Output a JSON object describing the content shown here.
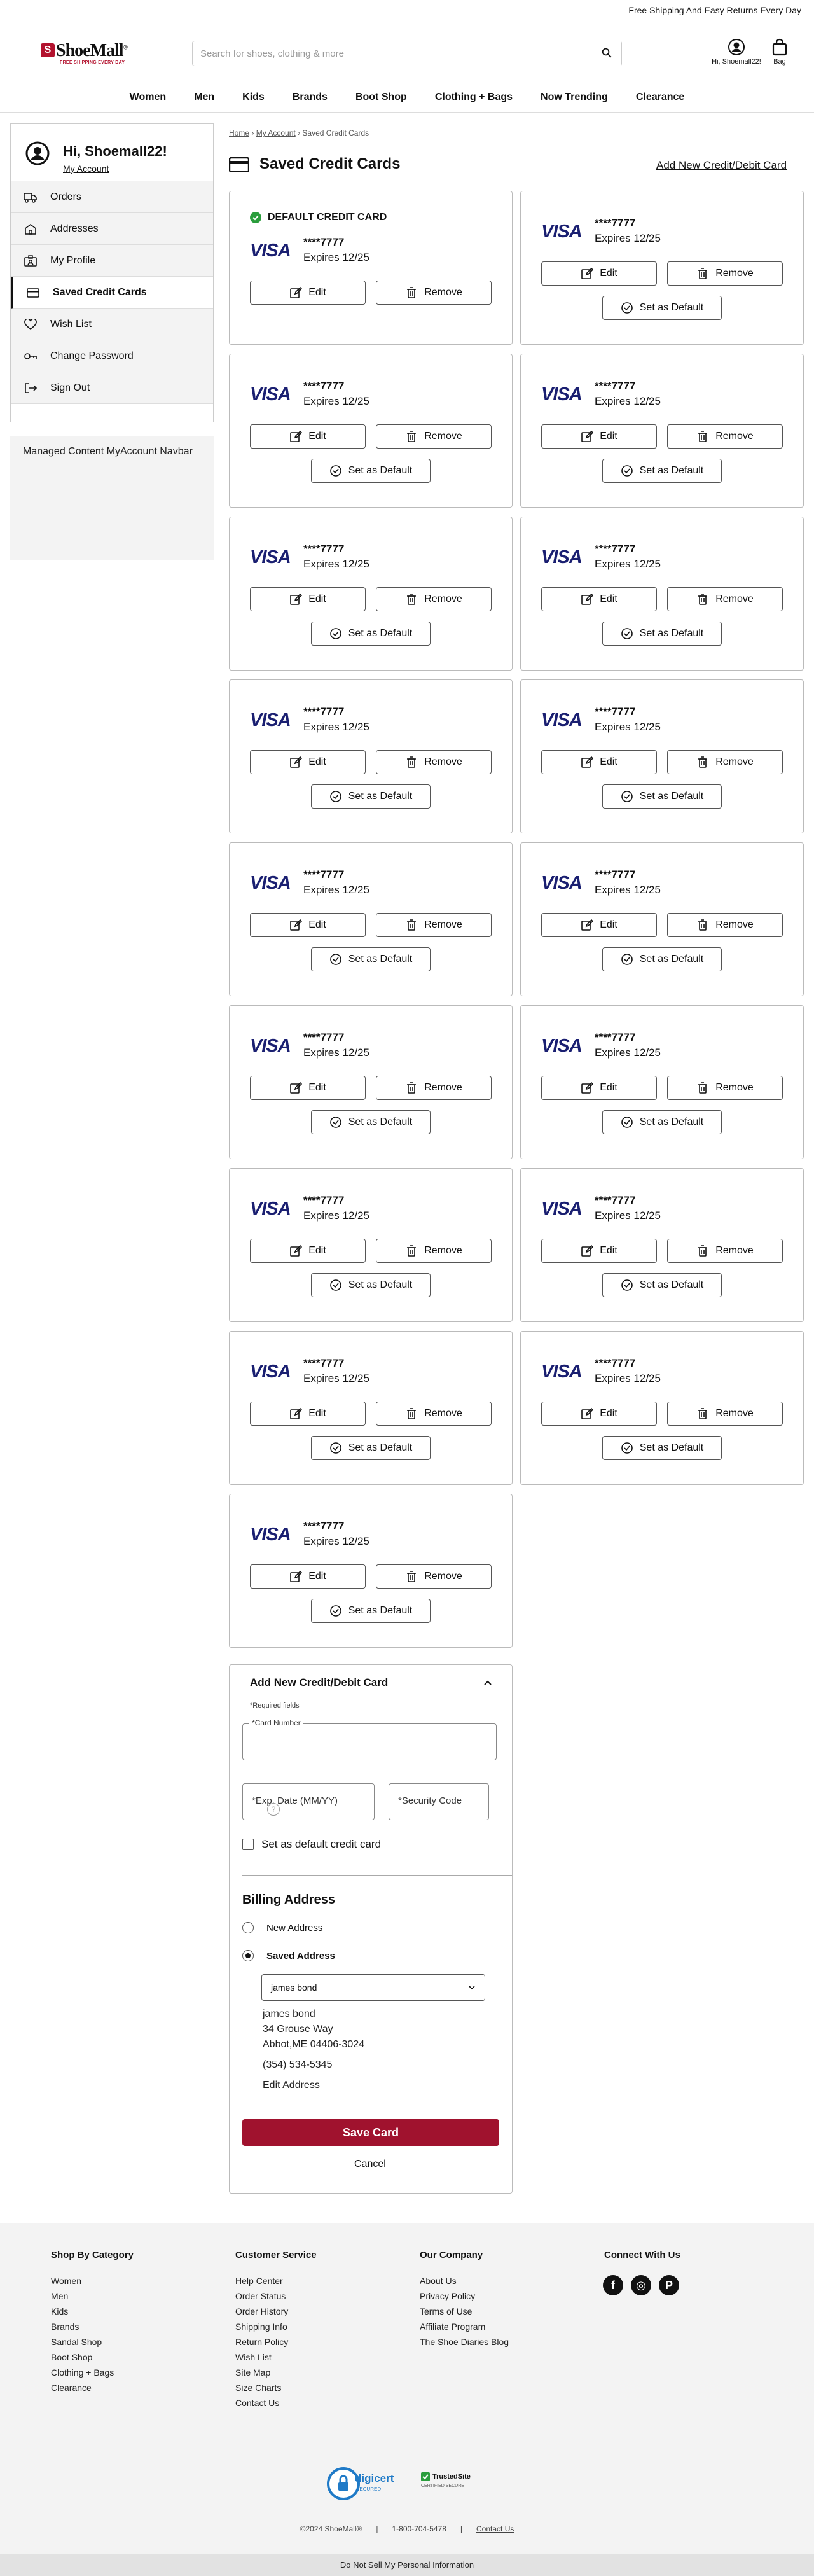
{
  "topbar": {
    "promo": "Free Shipping And Easy Returns Every Day"
  },
  "brand": {
    "name": "ShoeMall",
    "tagline": "FREE SHIPPING EVERY DAY",
    "mark": "S",
    "reg": "®",
    "color": "#b3122e"
  },
  "search": {
    "placeholder": "Search for shoes, clothing & more"
  },
  "header": {
    "account_label": "Hi, Shoemall22!",
    "bag_label": "Bag"
  },
  "nav": {
    "items": [
      "Women",
      "Men",
      "Kids",
      "Brands",
      "Boot Shop",
      "Clothing + Bags",
      "Now Trending",
      "Clearance"
    ]
  },
  "sidebar": {
    "greeting": "Hi, Shoemall22!",
    "my_account": "My Account",
    "items": [
      {
        "label": "Orders",
        "icon": "truck-icon"
      },
      {
        "label": "Addresses",
        "icon": "home-icon"
      },
      {
        "label": "My Profile",
        "icon": "profile-icon"
      },
      {
        "label": "Saved Credit Cards",
        "icon": "credit-card-icon",
        "active": true
      },
      {
        "label": "Wish List",
        "icon": "heart-icon"
      },
      {
        "label": "Change Password",
        "icon": "key-icon"
      },
      {
        "label": "Sign Out",
        "icon": "sign-out-icon"
      }
    ],
    "managed_content": "Managed Content MyAccount Navbar"
  },
  "breadcrumb": {
    "home": "Home",
    "my_account": "My Account",
    "current": "Saved Credit Cards"
  },
  "page": {
    "title": "Saved Credit Cards",
    "add_link": "Add New Credit/Debit Card"
  },
  "cards": {
    "default_label": "DEFAULT CREDIT CARD",
    "edit_label": "Edit",
    "remove_label": "Remove",
    "set_default_label": "Set as Default",
    "items": [
      {
        "brand": "VISA",
        "number": "****7777",
        "expires": "Expires 12/25",
        "is_default": true
      },
      {
        "brand": "VISA",
        "number": "****7777",
        "expires": "Expires 12/25"
      },
      {
        "brand": "VISA",
        "number": "****7777",
        "expires": "Expires 12/25"
      },
      {
        "brand": "VISA",
        "number": "****7777",
        "expires": "Expires 12/25"
      },
      {
        "brand": "VISA",
        "number": "****7777",
        "expires": "Expires 12/25"
      },
      {
        "brand": "VISA",
        "number": "****7777",
        "expires": "Expires 12/25"
      },
      {
        "brand": "VISA",
        "number": "****7777",
        "expires": "Expires 12/25"
      },
      {
        "brand": "VISA",
        "number": "****7777",
        "expires": "Expires 12/25"
      },
      {
        "brand": "VISA",
        "number": "****7777",
        "expires": "Expires 12/25"
      },
      {
        "brand": "VISA",
        "number": "****7777",
        "expires": "Expires 12/25"
      },
      {
        "brand": "VISA",
        "number": "****7777",
        "expires": "Expires 12/25"
      },
      {
        "brand": "VISA",
        "number": "****7777",
        "expires": "Expires 12/25"
      },
      {
        "brand": "VISA",
        "number": "****7777",
        "expires": "Expires 12/25"
      },
      {
        "brand": "VISA",
        "number": "****7777",
        "expires": "Expires 12/25"
      },
      {
        "brand": "VISA",
        "number": "****7777",
        "expires": "Expires 12/25"
      },
      {
        "brand": "VISA",
        "number": "****7777",
        "expires": "Expires 12/25"
      },
      {
        "brand": "VISA",
        "number": "****7777",
        "expires": "Expires 12/25"
      }
    ]
  },
  "form": {
    "title": "Add New Credit/Debit Card",
    "required_note": "*Required fields",
    "card_number_label": "*Card Number",
    "card_number_value": "",
    "exp_placeholder": "*Exp. Date (MM/YY)",
    "cvv_placeholder": "*Security Code",
    "help_glyph": "?",
    "default_checkbox": "Set as default credit card",
    "billing_title": "Billing Address",
    "new_address": "New Address",
    "saved_address": "Saved Address",
    "selected_address": "james bond",
    "address_lines": [
      "james bond",
      "34 Grouse Way",
      "Abbot,ME 04406-3024"
    ],
    "phone": "(354) 534-5345",
    "edit_address": "Edit Address",
    "save_button": "Save Card",
    "cancel": "Cancel"
  },
  "footer": {
    "columns": [
      {
        "title": "Shop By Category",
        "links": [
          "Women",
          "Men",
          "Kids",
          "Brands",
          "Sandal Shop",
          "Boot Shop",
          "Clothing + Bags",
          "Clearance"
        ]
      },
      {
        "title": "Customer Service",
        "links": [
          "Help Center",
          "Order Status",
          "Order History",
          "Shipping Info",
          "Return Policy",
          "Wish List",
          "Site Map",
          "Size Charts",
          "Contact Us"
        ]
      },
      {
        "title": "Our Company",
        "links": [
          "About Us",
          "Privacy Policy",
          "Terms of Use",
          "Affiliate Program",
          "The Shoe Diaries Blog"
        ]
      }
    ],
    "connect_title": "Connect With Us",
    "social": [
      "f",
      "◎",
      "P"
    ],
    "badges": {
      "digicert": "digicert",
      "digicert_sub": "SECURED",
      "trusted": "TrustedSite",
      "trusted_sub": "CERTIFIED SECURE"
    },
    "copyright": "©2024 ShoeMall®",
    "phone": "1-800-704-5478",
    "contact": "Contact Us",
    "do_not_sell": "Do Not Sell My Personal Information"
  }
}
